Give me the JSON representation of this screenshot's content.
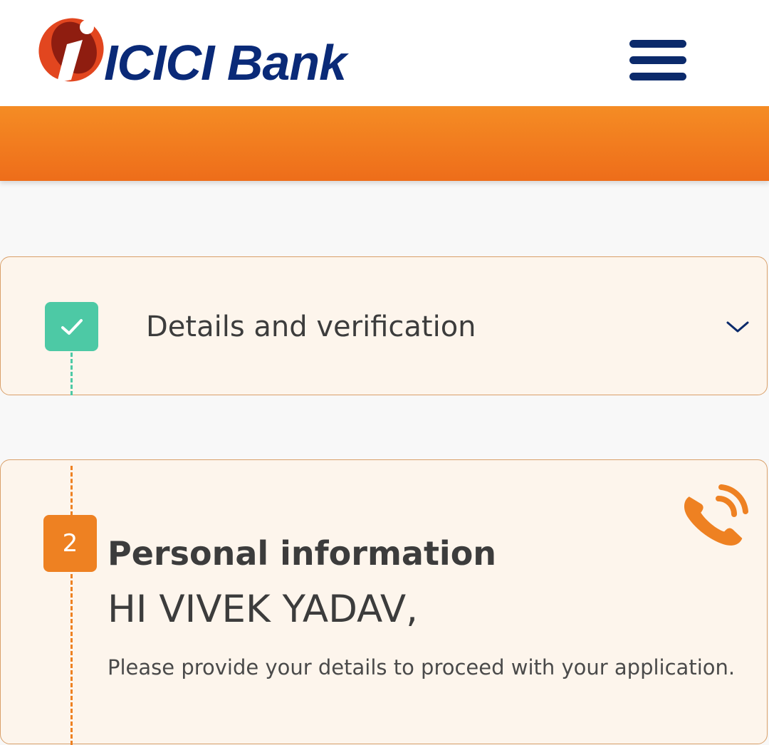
{
  "header": {
    "brand_name": "ICICI Bank",
    "logo_icon": "icici-logo-mark",
    "menu_icon": "hamburger-menu-icon"
  },
  "colors": {
    "brand_blue": "#0a2a78",
    "brand_orange": "#ee8122",
    "success_green": "#4dc9a5",
    "card_background": "#fdf5ec",
    "card_border": "#d9a06a"
  },
  "steps": [
    {
      "status": "completed",
      "status_icon": "checkmark-icon",
      "title": "Details and verification",
      "toggle_icon": "chevron-down-icon"
    },
    {
      "status": "active",
      "number": "2",
      "title": "Personal information",
      "greeting": "HI VIVEK YADAV,",
      "instruction": "Please provide your details to proceed with your application.",
      "action_icon": "phone-call-icon"
    }
  ]
}
